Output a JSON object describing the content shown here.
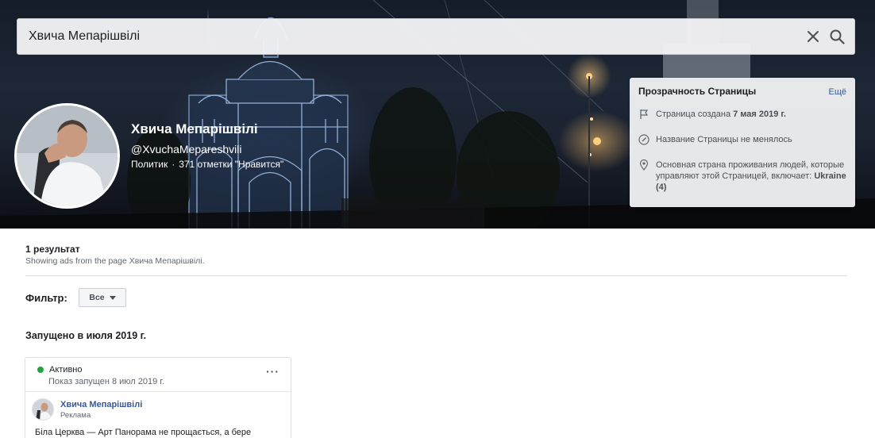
{
  "search": {
    "value": "Хвича Мепарішвілі",
    "clear_icon": "close-icon",
    "search_icon": "search-icon"
  },
  "page": {
    "name": "Хвича Мепарішвілі",
    "handle": "@XvuchaMepareshvili",
    "category": "Политик",
    "separator": "·",
    "likes": "371 отметки \"Нравится\""
  },
  "transparency": {
    "title": "Прозрачность Страницы",
    "more_link": "Ещё",
    "created_prefix": "Страница создана",
    "created_date": "7 мая 2019 г.",
    "name_unchanged": "Название Страницы не менялось",
    "country_text": "Основная страна проживания людей, которые управляют этой Страницей, включает:",
    "country_value": "Ukraine (4)",
    "icons": [
      "flag-icon",
      "edit-icon",
      "location-pin-icon"
    ]
  },
  "results": {
    "count": "1 результат",
    "subtitle": "Showing ads from the page Хвича Мепарішвілі.",
    "filter_label": "Фильтр:",
    "filter_value": "Все",
    "launched_heading": "Запущено в июля 2019 г."
  },
  "ad": {
    "status": "Активно",
    "started": "Показ запущен 8 июл 2019 г.",
    "menu": "···",
    "page_name": "Хвича Мепарішвілі",
    "sponsored": "Реклама",
    "text": "Біла Церква — Арт Панорама не прощається, а бере"
  },
  "colors": {
    "link": "#385898",
    "active_green": "#23a440",
    "panel_bg": "#eceef1"
  }
}
